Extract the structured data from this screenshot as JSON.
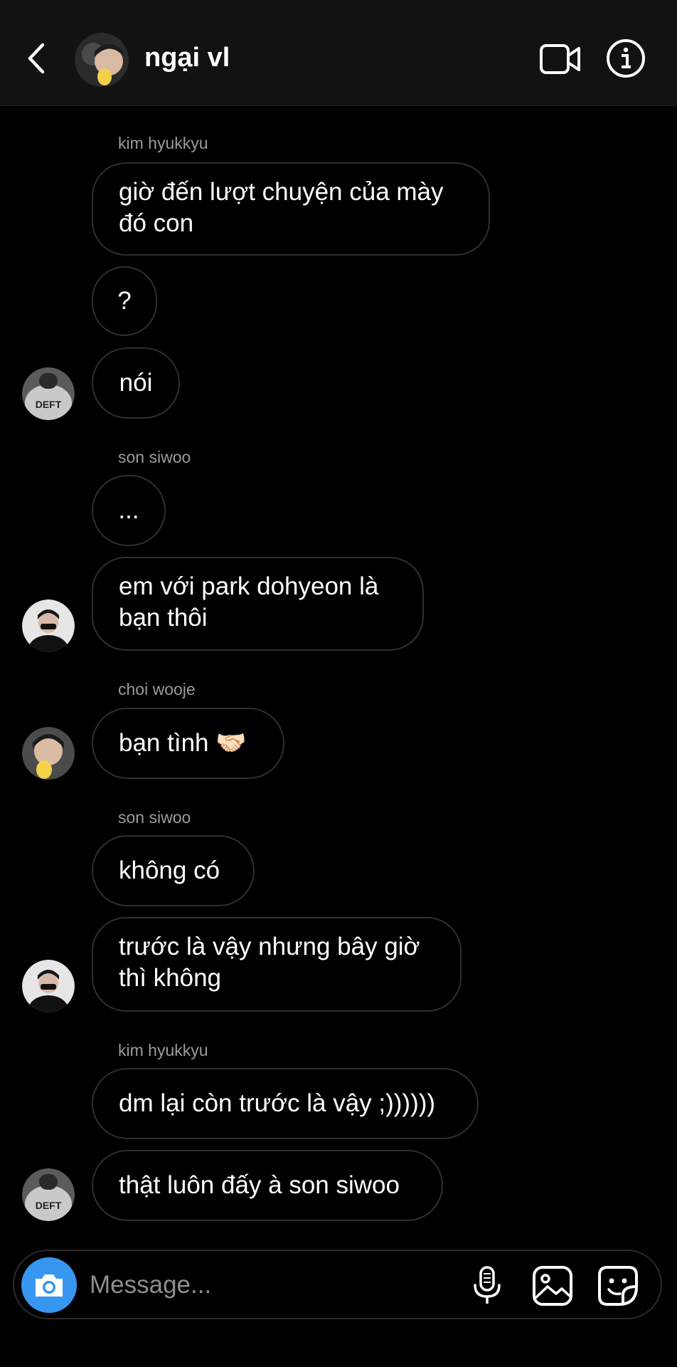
{
  "header": {
    "title": "ngại vl",
    "avatar_icon": "group-avatar",
    "back_icon": "chevron-left-icon",
    "video_icon": "video-camera-icon",
    "info_icon": "info-icon"
  },
  "messages": {
    "m1": {
      "sender": "kim hyukkyu",
      "line1": "giờ đến lượt chuyện của mày",
      "line2": "đó con"
    },
    "m2": {
      "text": "?"
    },
    "m3": {
      "text": "nói"
    },
    "m4": {
      "sender": "son siwoo",
      "text": "..."
    },
    "m5": {
      "line1": "em với park dohyeon là",
      "line2": "bạn thôi"
    },
    "m6": {
      "sender": "choi wooje",
      "text": "bạn tình 🤝🏻"
    },
    "m7": {
      "sender": "son siwoo",
      "text": "không có"
    },
    "m8": {
      "line1": "trước là vậy nhưng bây giờ",
      "line2": "thì không"
    },
    "m9": {
      "sender": "kim hyukkyu",
      "text": "dm lại còn trước là vậy ;))))))"
    },
    "m10": {
      "text": "thật luôn đấy à son siwoo"
    }
  },
  "avatars": {
    "kim_hyukkyu": {
      "caption": "DEFT"
    }
  },
  "composer": {
    "placeholder": "Message...",
    "camera_icon": "camera-icon",
    "mic_icon": "microphone-icon",
    "gallery_icon": "image-icon",
    "sticker_icon": "sticker-icon"
  },
  "colors": {
    "background": "#000000",
    "header_bg": "#121212",
    "bubble_border": "#2f2f2f",
    "camera_button": "#3797f0",
    "sender_text": "#9a9a9a"
  }
}
